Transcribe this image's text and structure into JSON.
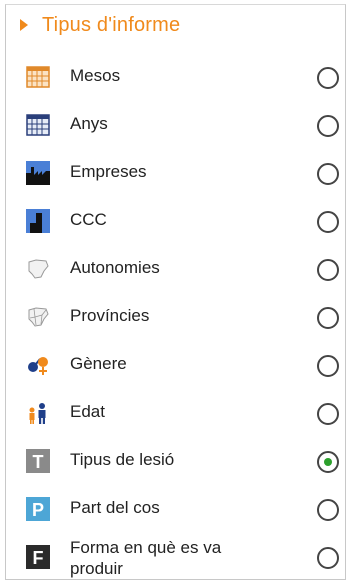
{
  "header": {
    "title": "Tipus d'informe"
  },
  "options": [
    {
      "label": "Mesos",
      "icon": "calendar-orange-icon",
      "checked": false
    },
    {
      "label": "Anys",
      "icon": "calendar-blue-icon",
      "checked": false
    },
    {
      "label": "Empreses",
      "icon": "factory-icon",
      "checked": false
    },
    {
      "label": "CCC",
      "icon": "chimney-icon",
      "checked": false
    },
    {
      "label": "Autonomies",
      "icon": "spain-map-icon",
      "checked": false
    },
    {
      "label": "Províncies",
      "icon": "provinces-map-icon",
      "checked": false
    },
    {
      "label": "Gènere",
      "icon": "gender-icon",
      "checked": false
    },
    {
      "label": "Edat",
      "icon": "age-people-icon",
      "checked": false
    },
    {
      "label": "Tipus de lesió",
      "icon": "letter-t-icon",
      "checked": true
    },
    {
      "label": "Part del cos",
      "icon": "letter-p-icon",
      "checked": false
    },
    {
      "label": "Forma en què es va produir",
      "icon": "letter-f-icon",
      "checked": false
    }
  ],
  "colors": {
    "accent": "#f08a1c",
    "selected_dot": "#2ca02c"
  }
}
